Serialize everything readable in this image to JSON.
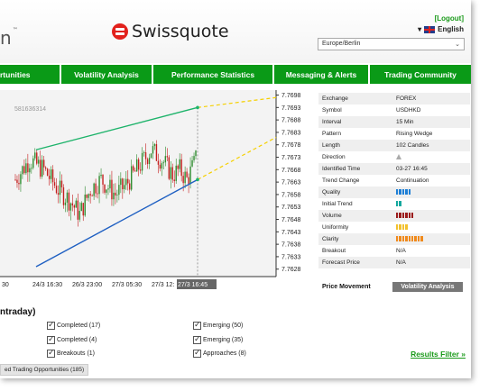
{
  "header": {
    "partial_logo": "n",
    "partial_logo_mark": "™",
    "brand_name": "Swissquote",
    "logout_label": "[Logout]",
    "language_label": "English",
    "timezone_value": "Europe/Berlin"
  },
  "nav": {
    "items": [
      {
        "label": "rtunities",
        "w": 0
      },
      {
        "label": "Volatility Analysis"
      },
      {
        "label": "Performance Statistics"
      },
      {
        "label": "Messaging & Alerts"
      },
      {
        "label": "Trading Community"
      }
    ]
  },
  "chart_data": {
    "type": "candlestick",
    "symbol_code_label": "581636314",
    "y_ticks": [
      "7.7698",
      "7.7693",
      "7.7688",
      "7.7683",
      "7.7678",
      "7.7673",
      "7.7668",
      "7.7663",
      "7.7658",
      "7.7653",
      "7.7648",
      "7.7643",
      "7.7638",
      "7.7633",
      "7.7628"
    ],
    "x_ticks": [
      "30",
      "24/3 16:30",
      "26/3 23:00",
      "27/3 05:30",
      "27/3 12:",
      "27/3 16:45"
    ],
    "ylim": [
      7.7625,
      7.77
    ],
    "pattern": "Rising Wedge",
    "upper_line": {
      "from": 7.7676,
      "to": 7.7693
    },
    "lower_line": {
      "from": 7.7629,
      "to": 7.7664
    }
  },
  "info": {
    "rows": [
      {
        "key": "Exchange",
        "value": "FOREX"
      },
      {
        "key": "Symbol",
        "value": "USDHKD"
      },
      {
        "key": "Interval",
        "value": "15 Min"
      },
      {
        "key": "Pattern",
        "value": "Rising Wedge"
      },
      {
        "key": "Length",
        "value": "102 Candles"
      },
      {
        "key": "Direction",
        "value": "",
        "icon": "up-triangle-icon"
      },
      {
        "key": "Identified Time",
        "value": "03-27 16:45"
      },
      {
        "key": "Trend Change",
        "value": "Continuation"
      },
      {
        "key": "Quality",
        "value": "",
        "bars": 5,
        "color": "#1e7fd6"
      },
      {
        "key": "Initial Trend",
        "value": "",
        "bars": 2,
        "color": "#13a89e"
      },
      {
        "key": "Volume",
        "value": "",
        "bars": 6,
        "color": "#9b1c1c"
      },
      {
        "key": "Uniformity",
        "value": "",
        "bars": 4,
        "color": "#f2c12e"
      },
      {
        "key": "Clarity",
        "value": "",
        "bars": 9,
        "color": "#f08a1c"
      },
      {
        "key": "Breakout",
        "value": "N/A"
      },
      {
        "key": "Forecast Price",
        "value": "N/A"
      }
    ],
    "price_movement_label": "Price Movement",
    "volatility_button_label": "Volatility Analysis"
  },
  "filters": {
    "section_title": "ntraday)",
    "left": [
      {
        "label": "Completed (17)"
      },
      {
        "label": "Completed (4)"
      },
      {
        "label": "Breakouts (1)"
      }
    ],
    "right": [
      {
        "label": "Emerging (50)"
      },
      {
        "label": "Emerging (35)"
      },
      {
        "label": "Approaches (8)"
      }
    ],
    "results_filter_label": "Results Filter »",
    "bottom_tab_label": "ed Trading Opportunities (185)"
  },
  "colors": {
    "nav_green": "#0a9a17",
    "up_candle": "#2e8b2e",
    "down_candle": "#c41e1e",
    "upper_trend": "#1db36a",
    "lower_trend": "#1e5fc2",
    "projection": "#f5d000"
  }
}
